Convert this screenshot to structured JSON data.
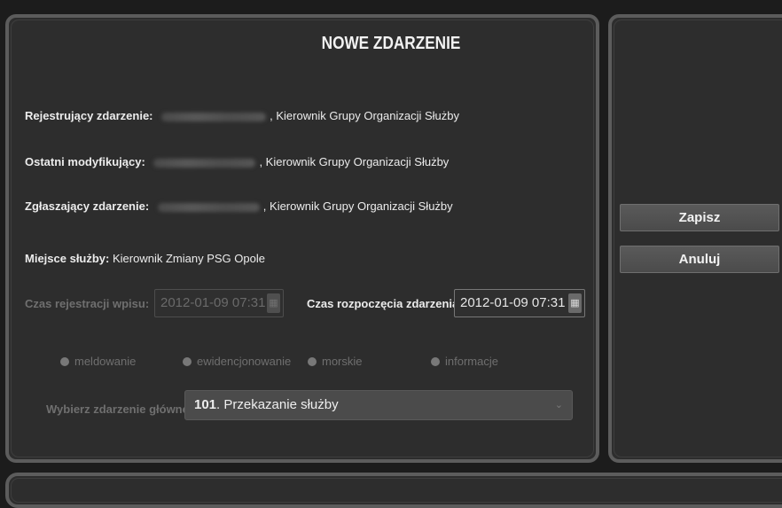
{
  "form": {
    "title": "NOWE ZDARZENIE",
    "rows": [
      {
        "label": "Rejestrujący zdarzenie:",
        "suffix": ", Kierownik Grupy Organizacji Służby"
      },
      {
        "label": "Ostatni modyfikujący:",
        "suffix": ", Kierownik Grupy Organizacji Służby"
      },
      {
        "label": "Zgłaszający zdarzenie:",
        "suffix": ", Kierownik Grupy Organizacji Służby"
      }
    ],
    "place_label": "Miejsce służby:",
    "place_value": "Kierownik Zmiany PSG Opole",
    "reg_time_label": "Czas rejestracji wpisu:",
    "reg_time_value": "2012-01-09 07:31",
    "start_time_label": "Czas rozpoczęcia zdarzenia:",
    "start_time_value": "2012-01-09 07:31",
    "radios": [
      "meldowanie",
      "ewidencjonowanie",
      "morskie",
      "informacje"
    ],
    "select_label": "Wybierz zdarzenie główne:",
    "select_code": "101",
    "select_text": ". Przekazanie służby"
  },
  "actions": {
    "save_label": "Zapisz",
    "cancel_label": "Anuluj"
  },
  "icons": {
    "calendar": "calendar-icon",
    "dropdown": "chevron-down-icon"
  },
  "colors": {
    "background": "#1c1c1c",
    "panel": "#2d2d2d",
    "panel_border": "#5c5c5c",
    "button": "#4f4f4f"
  }
}
